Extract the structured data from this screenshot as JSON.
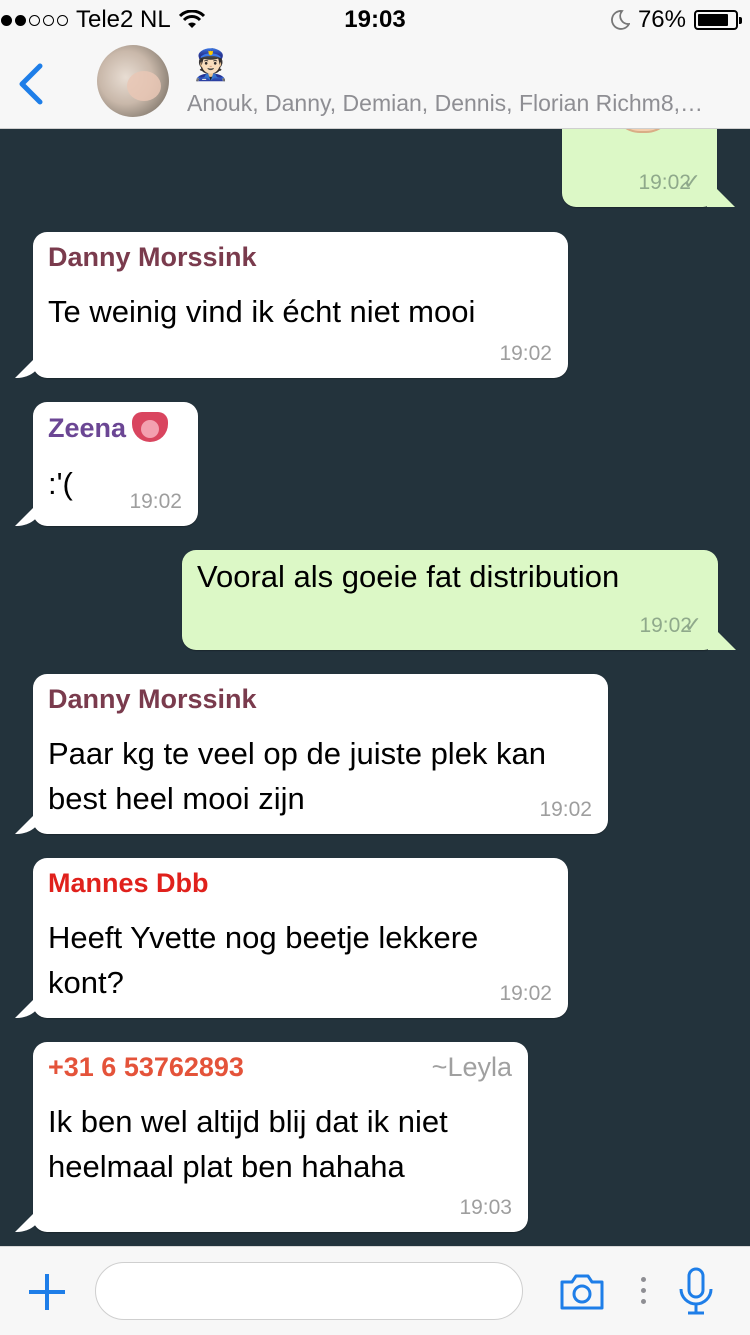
{
  "status_bar": {
    "carrier": "Tele2 NL",
    "time": "19:03",
    "battery": "76%",
    "battery_level": 0.76,
    "signal_bars_filled": 2,
    "signal_bars_total": 5
  },
  "header": {
    "members": "Anouk, Danny, Demian, Dennis, Florian Richm8,…",
    "group_emoji": "👮🏻"
  },
  "messages": [
    {
      "direction": "out",
      "time": "19:02",
      "status": "sent"
    },
    {
      "direction": "in",
      "sender": "Danny Morssink",
      "sender_color": "#7a3b4d",
      "text": "Te weinig vind ik écht niet mooi",
      "time": "19:02"
    },
    {
      "direction": "in",
      "sender": "Zeena",
      "sender_color": "#6b4694",
      "text": ":'(",
      "time": "19:02"
    },
    {
      "direction": "out",
      "text": "Vooral als goeie fat distribution",
      "time": "19:02",
      "status": "sent"
    },
    {
      "direction": "in",
      "sender": "Danny Morssink",
      "sender_color": "#7a3b4d",
      "text_line1": "Paar kg te veel op de juiste plek kan",
      "text_line2": "best heel mooi zijn",
      "time": "19:02"
    },
    {
      "direction": "in",
      "sender": "Mannes Dbb",
      "sender_color": "#e0211c",
      "text_line1": "Heeft Yvette nog beetje lekkere",
      "text_line2": "kont?",
      "time": "19:02"
    },
    {
      "direction": "in",
      "sender": "+31 6 53762893",
      "sender_color": "#e4533a",
      "push_name": "~Leyla",
      "text_line1": "Ik ben wel altijd blij dat ik niet",
      "text_line2": "heelmaal plat ben hahaha",
      "time": "19:03"
    }
  ],
  "icons": {
    "back": "chevron-left-icon",
    "attach": "plus-icon",
    "camera": "camera-icon",
    "more": "more-dots-icon",
    "mic": "microphone-icon",
    "moon": "moon-icon",
    "wifi": "wifi-icon",
    "read_tick": "check-icon"
  },
  "colors": {
    "accent": "#1e7ee8",
    "chat_background": "#23333c",
    "outgoing_bubble": "#dcf8c6",
    "incoming_bubble": "#ffffff"
  }
}
